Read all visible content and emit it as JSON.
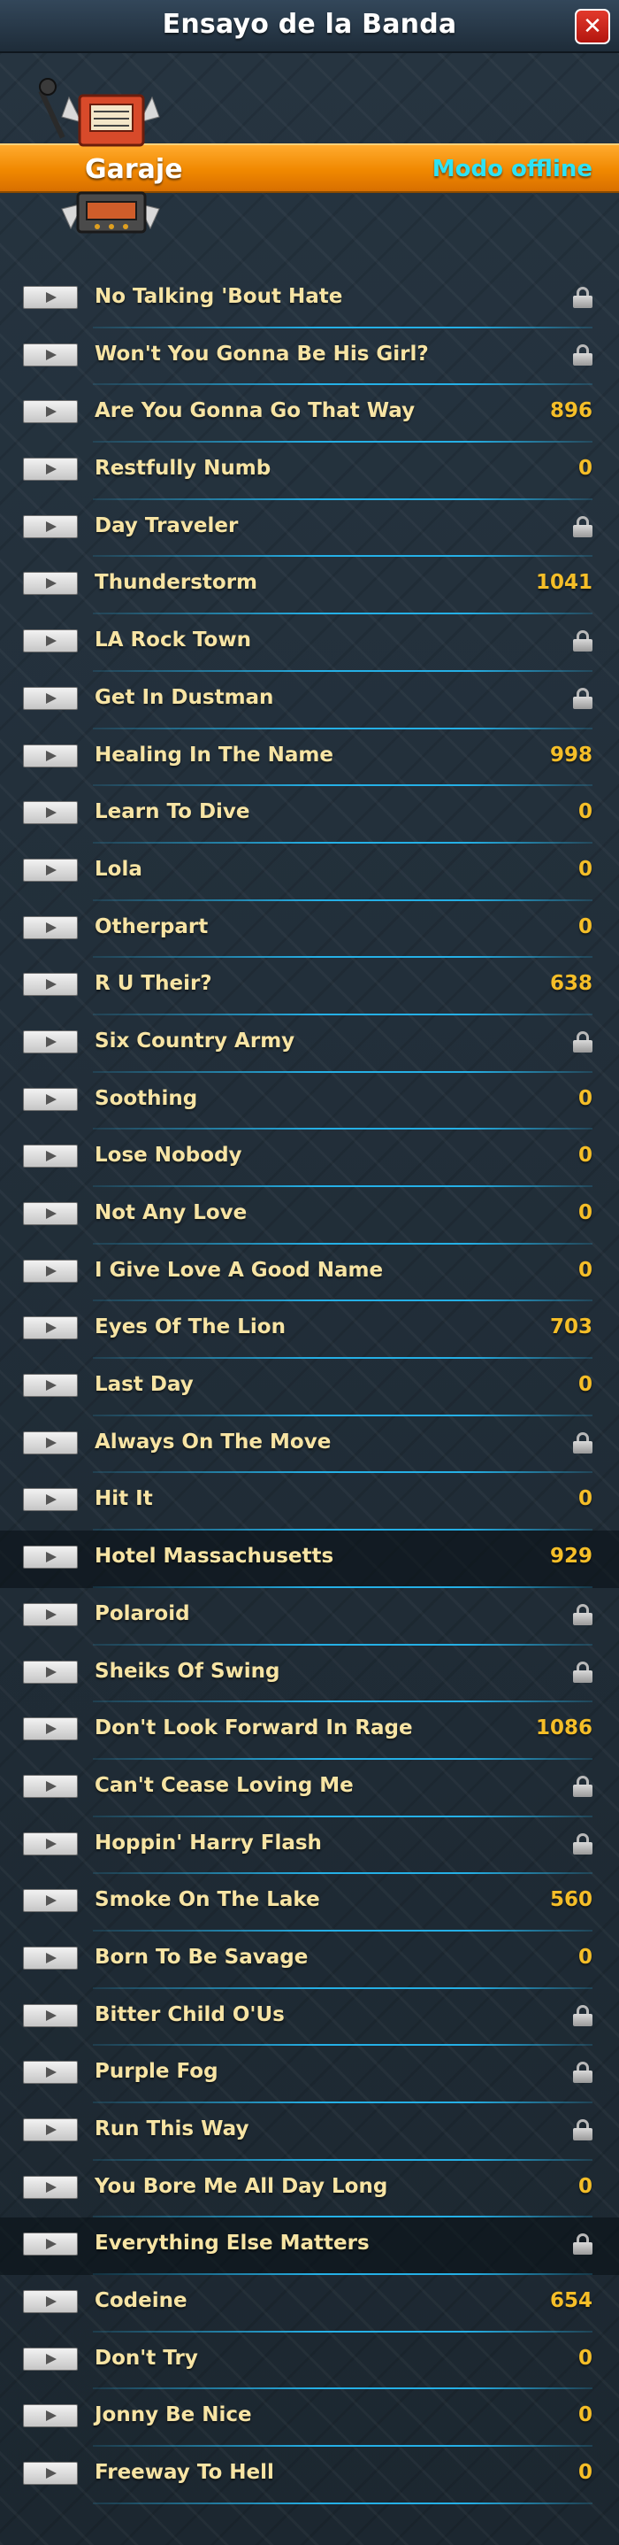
{
  "header": {
    "title": "Ensayo de la Banda",
    "close_icon": "close-icon"
  },
  "venue": {
    "name": "Garaje",
    "status": "Modo offline",
    "icon": "amp-speaker-icon"
  },
  "songs": [
    {
      "title": "No Talking 'Bout Hate",
      "score": "",
      "locked": true
    },
    {
      "title": "Won't You Gonna Be His Girl?",
      "score": "",
      "locked": true
    },
    {
      "title": "Are You Gonna Go That Way",
      "score": "896",
      "locked": false
    },
    {
      "title": "Restfully Numb",
      "score": "0",
      "locked": false
    },
    {
      "title": "Day Traveler",
      "score": "",
      "locked": true
    },
    {
      "title": "Thunderstorm",
      "score": "1041",
      "locked": false
    },
    {
      "title": "LA Rock Town",
      "score": "",
      "locked": true
    },
    {
      "title": "Get In Dustman",
      "score": "",
      "locked": true
    },
    {
      "title": "Healing In The Name",
      "score": "998",
      "locked": false
    },
    {
      "title": "Learn To Dive",
      "score": "0",
      "locked": false
    },
    {
      "title": "Lola",
      "score": "0",
      "locked": false
    },
    {
      "title": "Otherpart",
      "score": "0",
      "locked": false
    },
    {
      "title": "R U Their?",
      "score": "638",
      "locked": false
    },
    {
      "title": "Six Country Army",
      "score": "",
      "locked": true
    },
    {
      "title": "Soothing",
      "score": "0",
      "locked": false
    },
    {
      "title": "Lose Nobody",
      "score": "0",
      "locked": false
    },
    {
      "title": "Not Any Love",
      "score": "0",
      "locked": false
    },
    {
      "title": "I Give Love A Good Name",
      "score": "0",
      "locked": false
    },
    {
      "title": "Eyes Of The Lion",
      "score": "703",
      "locked": false
    },
    {
      "title": "Last Day",
      "score": "0",
      "locked": false
    },
    {
      "title": "Always On The Move",
      "score": "",
      "locked": true
    },
    {
      "title": "Hit It",
      "score": "0",
      "locked": false
    },
    {
      "title": "Hotel Massachusetts",
      "score": "929",
      "locked": false,
      "highlight": true
    },
    {
      "title": "Polaroid",
      "score": "",
      "locked": true
    },
    {
      "title": "Sheiks Of Swing",
      "score": "",
      "locked": true
    },
    {
      "title": "Don't Look Forward In Rage",
      "score": "1086",
      "locked": false
    },
    {
      "title": "Can't Cease Loving Me",
      "score": "",
      "locked": true
    },
    {
      "title": "Hoppin' Harry Flash",
      "score": "",
      "locked": true
    },
    {
      "title": "Smoke On The Lake",
      "score": "560",
      "locked": false
    },
    {
      "title": "Born To Be Savage",
      "score": "0",
      "locked": false
    },
    {
      "title": "Bitter Child O'Us",
      "score": "",
      "locked": true
    },
    {
      "title": "Purple Fog",
      "score": "",
      "locked": true
    },
    {
      "title": "Run This Way",
      "score": "",
      "locked": true
    },
    {
      "title": "You Bore Me All Day Long",
      "score": "0",
      "locked": false
    },
    {
      "title": "Everything Else Matters",
      "score": "",
      "locked": true,
      "highlight": true
    },
    {
      "title": "Codeine",
      "score": "654",
      "locked": false
    },
    {
      "title": "Don't Try",
      "score": "0",
      "locked": false
    },
    {
      "title": "Jonny Be Nice",
      "score": "0",
      "locked": false
    },
    {
      "title": "Freeway To Hell",
      "score": "0",
      "locked": false
    }
  ]
}
